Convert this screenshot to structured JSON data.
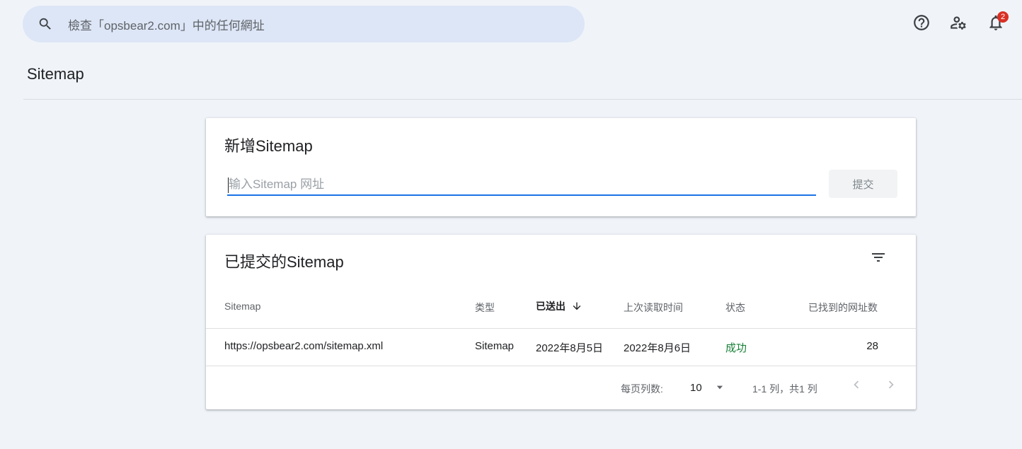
{
  "search": {
    "placeholder": "檢查「opsbear2.com」中的任何網址",
    "icon": "search-icon"
  },
  "header_icons": {
    "help": "help-circle-icon",
    "admin": "manage-accounts-icon",
    "notifications": "bell-icon",
    "notification_count": "2"
  },
  "page": {
    "title": "Sitemap"
  },
  "add_card": {
    "title": "新增Sitemap",
    "input_placeholder": "输入Sitemap 网址",
    "input_value": "",
    "submit_label": "提交"
  },
  "list_card": {
    "title": "已提交的Sitemap",
    "columns": [
      "Sitemap",
      "类型",
      "已送出",
      "上次读取时间",
      "状态",
      "已找到的网址数"
    ],
    "sorted_column": "已送出",
    "sort_direction": "descending",
    "rows": [
      {
        "sitemap": "https://opsbear2.com/sitemap.xml",
        "type": "Sitemap",
        "submitted": "2022年8月5日",
        "last_read": "2022年8月6日",
        "status": "成功",
        "urls_found": "28"
      }
    ],
    "footer": {
      "rows_per_page_label": "每页列数:",
      "rows_per_page_value": "10",
      "range_text": "1-1 列，共1 列"
    }
  },
  "colors": {
    "background": "#f0f4f9",
    "accent": "#1a73e8",
    "success": "#188038",
    "badge": "#d93025"
  }
}
